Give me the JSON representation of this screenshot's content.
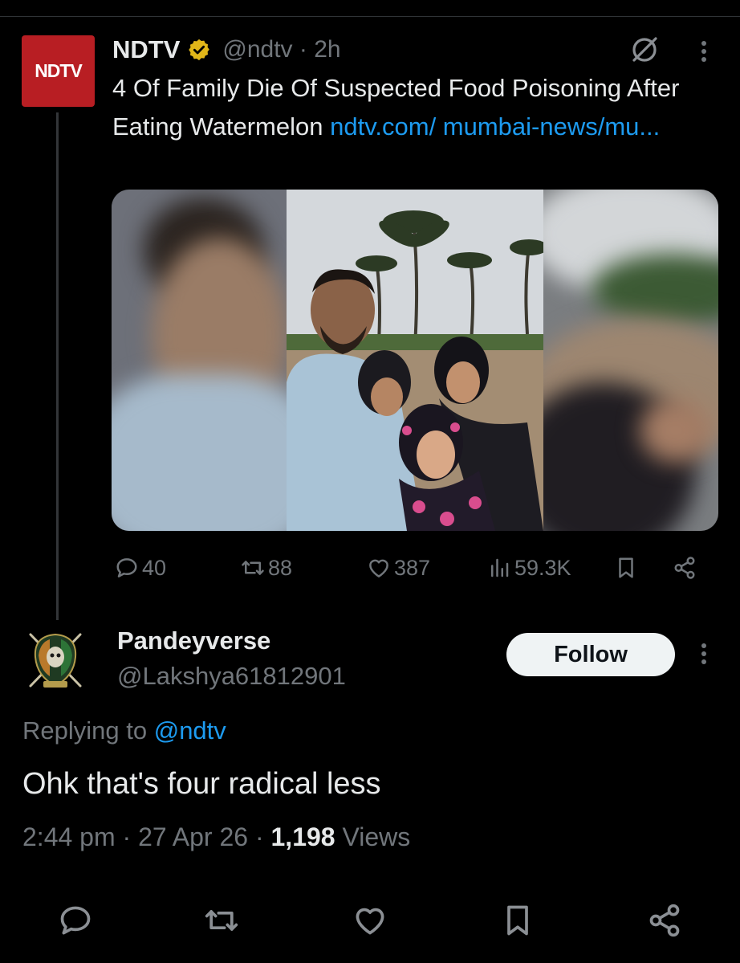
{
  "tweet": {
    "avatar_text": "NDTV",
    "author_name": "NDTV",
    "author_handle": "@ndtv · 2h",
    "text": "4 Of Family Die Of Suspected Food Poisoning After Eating Watermelon ",
    "link_text": "ndtv.com/ mumbai-news/mu...",
    "stats": {
      "replies": "40",
      "reposts": "88",
      "likes": "387",
      "views": "59.3K"
    }
  },
  "reply": {
    "author_name": "Pandeyverse",
    "author_handle": "@Lakshya61812901",
    "follow_label": "Follow",
    "replying_prefix": "Replying to ",
    "replying_mention": "@ndtv",
    "text": "Ohk that's four radical less",
    "time": "2:44 pm · 27 Apr 26 · ",
    "views_count": "1,198",
    "views_label": " Views"
  },
  "colors": {
    "background": "#000000",
    "text_primary": "#e7e9ea",
    "text_secondary": "#71767b",
    "link": "#1d9bf0",
    "verified_badge": "#e2b719",
    "ndtv_red": "#b81e23"
  },
  "icons": {
    "verified": "verified-badge-icon",
    "grok": "grok-icon",
    "more": "more-vertical-icon",
    "reply": "reply-icon",
    "repost": "repost-icon",
    "like": "like-icon",
    "views": "views-icon",
    "bookmark": "bookmark-icon",
    "share": "share-icon"
  }
}
